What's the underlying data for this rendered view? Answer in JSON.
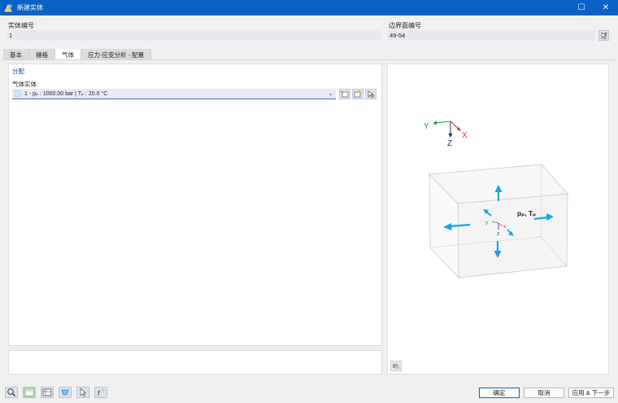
{
  "window": {
    "title": "新建实体",
    "maximize_glyph": "☐",
    "close_glyph": "✕"
  },
  "fields": {
    "solid_no_label": "实体编号",
    "solid_no_value": "1",
    "boundary_label": "边界面编号",
    "boundary_value": "49-54"
  },
  "tabs": [
    {
      "label": "基本"
    },
    {
      "label": "栅格"
    },
    {
      "label": "气体",
      "active": true
    },
    {
      "label": "应力-应变分析 - 配置"
    }
  ],
  "assignment": {
    "section_title": "分配",
    "gas_solid_label": "气体实体",
    "dropdown_value": "1 - pₚ : 1000.00 bar | Tₚ : 20.0 °C"
  },
  "view": {
    "axis_y": "Y",
    "axis_x": "X",
    "axis_z": "Z",
    "small_y": "y",
    "small_x": "x",
    "small_z": "z",
    "load_label": "pₚ, Tₚ"
  },
  "buttons": {
    "ok": "确定",
    "cancel": "取消",
    "apply_next": "应用 & 下一步"
  },
  "colors": {
    "title_bar": "#0a63c4",
    "arrow": "#1aa0e6",
    "axis_y": "#1b9e3a",
    "axis_x": "#d62d2d",
    "axis_z": "#1d2a8a"
  }
}
